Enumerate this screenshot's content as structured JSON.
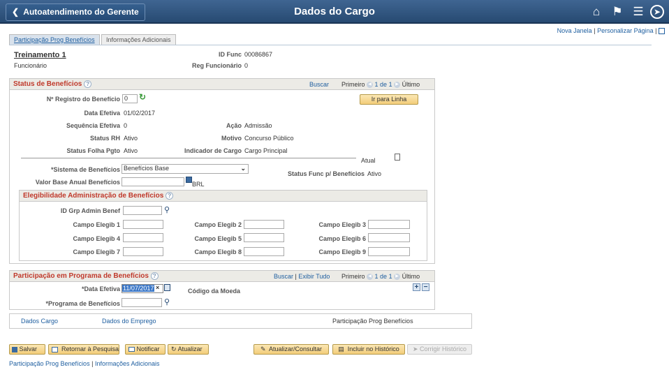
{
  "header": {
    "back_label": "Autoatendimento do Gerente",
    "title": "Dados do Cargo"
  },
  "toplinks": {
    "new_window": "Nova Janela",
    "personalize": "Personalizar Página",
    "sep": "|"
  },
  "tabs": [
    "Participação Prog Benefícios",
    "Informações Adicionais"
  ],
  "employee": {
    "name": "Treinamento 1",
    "role": "Funcionário",
    "id_label": "ID Func",
    "id_value": "00086867",
    "reg_label": "Reg Funcionário",
    "reg_value": "0"
  },
  "status": {
    "title": "Status de Benefícios",
    "search": "Buscar",
    "first": "Primeiro",
    "pages": "1 de 1",
    "last": "Último",
    "reg_label": "Nº Registro do Benefício",
    "reg_value": "0",
    "goto": "Ir para Linha",
    "date_label": "Data Efetiva",
    "date_value": "01/02/2017",
    "seq_label": "Sequência Efetiva",
    "seq_value": "0",
    "action_label": "Ação",
    "action_value": "Admissão",
    "hr_label": "Status RH",
    "hr_value": "Ativo",
    "reason_label": "Motivo",
    "reason_value": "Concurso Público",
    "payroll_label": "Status Folha Pgto",
    "payroll_value": "Ativo",
    "jobind_label": "Indicador de Cargo",
    "jobind_value": "Cargo Principal",
    "current": "Atual",
    "system_label": "*Sistema de Benefícios",
    "system_value": "Benefícios Base",
    "func_status_label": "Status Func p/ Benefícios",
    "func_status_value": "Ativo",
    "base_label": "Valor Base Anual Benefícios",
    "base_value": "",
    "currency": "BRL"
  },
  "elig": {
    "title": "Elegibilidade Administração de Benefícios",
    "grp_label": "ID Grp Admin Benef",
    "grp_value": "",
    "fields": [
      "Campo Elegib 1",
      "Campo Elegib 2",
      "Campo Elegib 3",
      "Campo Elegib 4",
      "Campo Elegib 5",
      "Campo Elegib 6",
      "Campo Elegib 7",
      "Campo Elegib 8",
      "Campo Elegib 9"
    ]
  },
  "program": {
    "title": "Participação em Programa de Benefícios",
    "search": "Buscar",
    "sep": "|",
    "view_all": "Exibir Tudo",
    "first": "Primeiro",
    "pages": "1 de 1",
    "last": "Último",
    "date_label": "*Data Efetiva",
    "date_value": "11/07/2017",
    "currency_label": "Código da Moeda",
    "prog_label": "*Programa de Benefícios",
    "prog_value": ""
  },
  "subnav": {
    "job": "Dados Cargo",
    "employment": "Dados do Emprego",
    "current": "Participação Prog Benefícios"
  },
  "actions": {
    "save": "Salvar",
    "return": "Retornar à Pesquisa",
    "notify": "Notificar",
    "refresh": "Atualizar",
    "update": "Atualizar/Consultar",
    "include": "Incluir no Histórico",
    "correct": "Corrigir Histórico"
  },
  "footer": {
    "link1": "Participação Prog Benefícios",
    "sep": "|",
    "link2": "Informações Adicionais"
  }
}
